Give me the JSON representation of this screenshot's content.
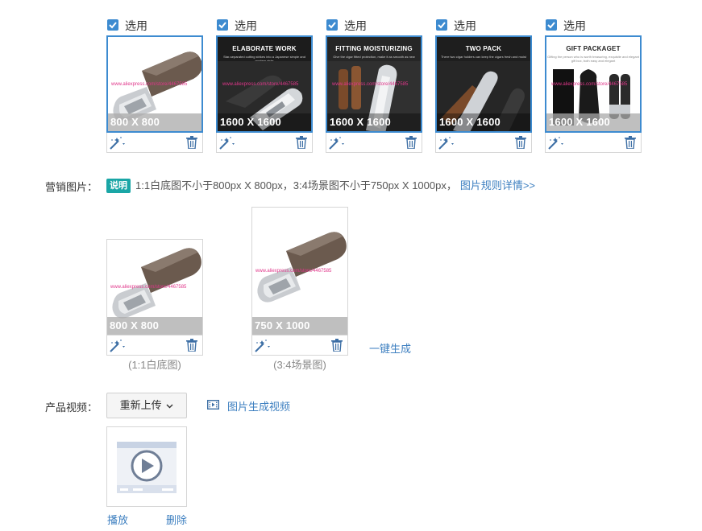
{
  "top_row": {
    "select_label": "选用",
    "images": [
      {
        "size": "800 X 800",
        "kind": "white-bg",
        "watermark": "www.aliexpress.com/store/4467585"
      },
      {
        "size": "1600 X 1600",
        "kind": "banner",
        "banner_title": "ELABORATE WORK",
        "banner_sub": "Star-separated cutting strikes into a Japanese simple and modern style",
        "watermark": "www.aliexpress.com/store/4467585"
      },
      {
        "size": "1600 X 1600",
        "kind": "banner",
        "banner_title": "FITTING MOISTURIZING",
        "banner_sub": "Give the cigar fitted protection, make it as smooth as new",
        "watermark": "www.aliexpress.com/store/4467585"
      },
      {
        "size": "1600 X 1600",
        "kind": "banner",
        "banner_title": "TWO PACK",
        "banner_sub": "There two cigar holders can keep the cigars fresh and moist",
        "watermark": ""
      },
      {
        "size": "1600 X 1600",
        "kind": "gift",
        "banner_title": "GIFT PACKAGET",
        "banner_sub": "Gifting the person who is worth treasuring, exquisite and elegant gift box, both easy and elegant",
        "watermark": "www.aliexpress.com/store/4467585"
      }
    ]
  },
  "marketing": {
    "label": "营销图片：",
    "badge": "说明",
    "hint": "1:1白底图不小于800px X 800px，3:4场景图不小于750px X 1000px，",
    "rules_link": "图片规则详情>>",
    "images": [
      {
        "size": "800 X 800",
        "caption": "(1:1白底图)",
        "watermark": "www.aliexpress.com/store/4467585"
      },
      {
        "size": "750 X 1000",
        "caption": "(3:4场景图)",
        "watermark": "www.aliexpress.com/store/4467585"
      }
    ],
    "generate_link": "一键生成"
  },
  "video": {
    "label": "产品视频：",
    "reupload_button": "重新上传",
    "generate_link": "图片生成视频",
    "play_link": "播放",
    "delete_link": "删除"
  },
  "colors": {
    "accent": "#3d8bd0",
    "badge": "#1aa6a6",
    "link": "#3d7fc0"
  }
}
